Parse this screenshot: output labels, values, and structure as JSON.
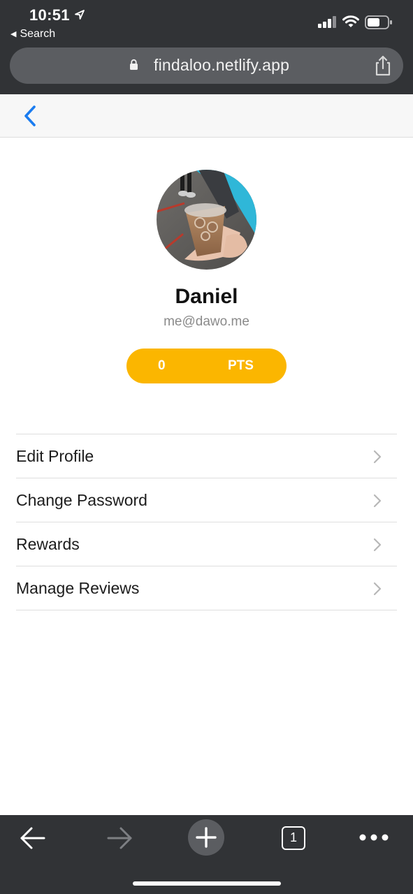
{
  "status_bar": {
    "time": "10:51",
    "back_app_label": "Search",
    "icons": [
      "location-arrow-icon",
      "cellular-signal-icon",
      "wifi-icon",
      "battery-icon"
    ]
  },
  "browser": {
    "url": "findaloo.netlify.app",
    "icons": [
      "lock-icon",
      "share-icon"
    ],
    "toolbar": {
      "tab_count": "1",
      "icons": [
        "back-arrow-icon",
        "forward-arrow-icon",
        "plus-icon",
        "tabs-icon",
        "more-icon"
      ]
    }
  },
  "app_header": {
    "icons": [
      "chevron-left-icon"
    ]
  },
  "profile": {
    "name": "Daniel",
    "email": "me@dawo.me",
    "points_value": "0",
    "points_unit": "PTS"
  },
  "menu": {
    "items": [
      {
        "label": "Edit Profile"
      },
      {
        "label": "Change Password"
      },
      {
        "label": "Rewards"
      },
      {
        "label": "Manage Reviews"
      }
    ],
    "icon": "chevron-right-icon"
  },
  "colors": {
    "chrome_background": "#313336",
    "url_field": "#5b5d61",
    "accent_blue": "#1a7cf0",
    "points_yellow": "#fbb600",
    "divider": "#dedede",
    "secondary_text": "#8a8a8a"
  }
}
